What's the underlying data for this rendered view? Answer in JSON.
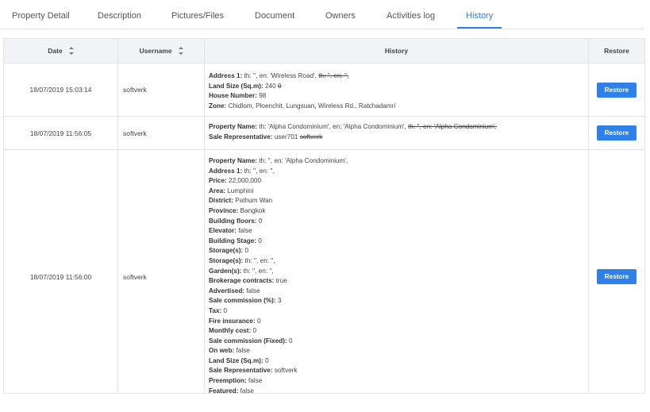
{
  "tabs": [
    "Property Detail",
    "Description",
    "Pictures/Files",
    "Document",
    "Owners",
    "Activities log",
    "History"
  ],
  "active_tab": "History",
  "columns": {
    "date": "Date",
    "username": "Username",
    "history": "History",
    "restore": "Restore"
  },
  "restore_label": "Restore",
  "rows": [
    {
      "date": "18/07/2019 15:03:14",
      "username": "softverk",
      "lines": [
        {
          "label": "Address 1:",
          "value": " th: '', en: 'Wireless Road', ",
          "old": "th: '', en: '',"
        },
        {
          "label": "Land Size (Sq.m):",
          "value": " 240 ",
          "old": "0"
        },
        {
          "label": "House Number:",
          "value": " 98"
        },
        {
          "label": "Zone:",
          "value": " Chidlom, Ploenchit, Lungsuan, Wireless Rd., Ratchadamri"
        }
      ]
    },
    {
      "date": "18/07/2019 11:56:05",
      "username": "softverk",
      "lines": [
        {
          "label": "Property Name:",
          "value": " th: 'Alpha Condominium', en: 'Alpha Condominium', ",
          "old": "th: '', en: 'Alpha Condominium',"
        },
        {
          "label": "Sale Representative:",
          "value": " user701 ",
          "old": "softverk"
        }
      ]
    },
    {
      "date": "18/07/2019 11:56:00",
      "username": "softverk",
      "lines": [
        {
          "label": "Property Name:",
          "value": " th: '', en: 'Alpha Condominium',"
        },
        {
          "label": "Address 1:",
          "value": " th: '', en: '',"
        },
        {
          "label": "Price:",
          "value": " 22,000,000"
        },
        {
          "label": "Area:",
          "value": " Lumphini"
        },
        {
          "label": "District:",
          "value": " Pathum Wan"
        },
        {
          "label": "Province:",
          "value": " Bangkok"
        },
        {
          "label": "Building floors:",
          "value": " 0"
        },
        {
          "label": "Elevator:",
          "value": " false"
        },
        {
          "label": "Building Stage:",
          "value": " 0"
        },
        {
          "label": "Storage(s):",
          "value": " 0"
        },
        {
          "label": "Storage(s):",
          "value": " th: '', en: '',"
        },
        {
          "label": "Garden(s):",
          "value": " th: '', en: '',"
        },
        {
          "label": "Brokerage contracts:",
          "value": " true"
        },
        {
          "label": "Advertised:",
          "value": " false"
        },
        {
          "label": "Sale commission (%):",
          "value": " 3"
        },
        {
          "label": "Tax:",
          "value": " 0"
        },
        {
          "label": "Fire insurance:",
          "value": " 0"
        },
        {
          "label": "Monthly cost:",
          "value": " 0"
        },
        {
          "label": "Sale commission (Fixed):",
          "value": " 0"
        },
        {
          "label": "On web:",
          "value": " false"
        },
        {
          "label": "Land Size (Sq.m):",
          "value": " 0"
        },
        {
          "label": "Sale Representative:",
          "value": " softverk"
        },
        {
          "label": "Preemption:",
          "value": " false"
        },
        {
          "label": "Featured:",
          "value": " false"
        }
      ]
    }
  ]
}
